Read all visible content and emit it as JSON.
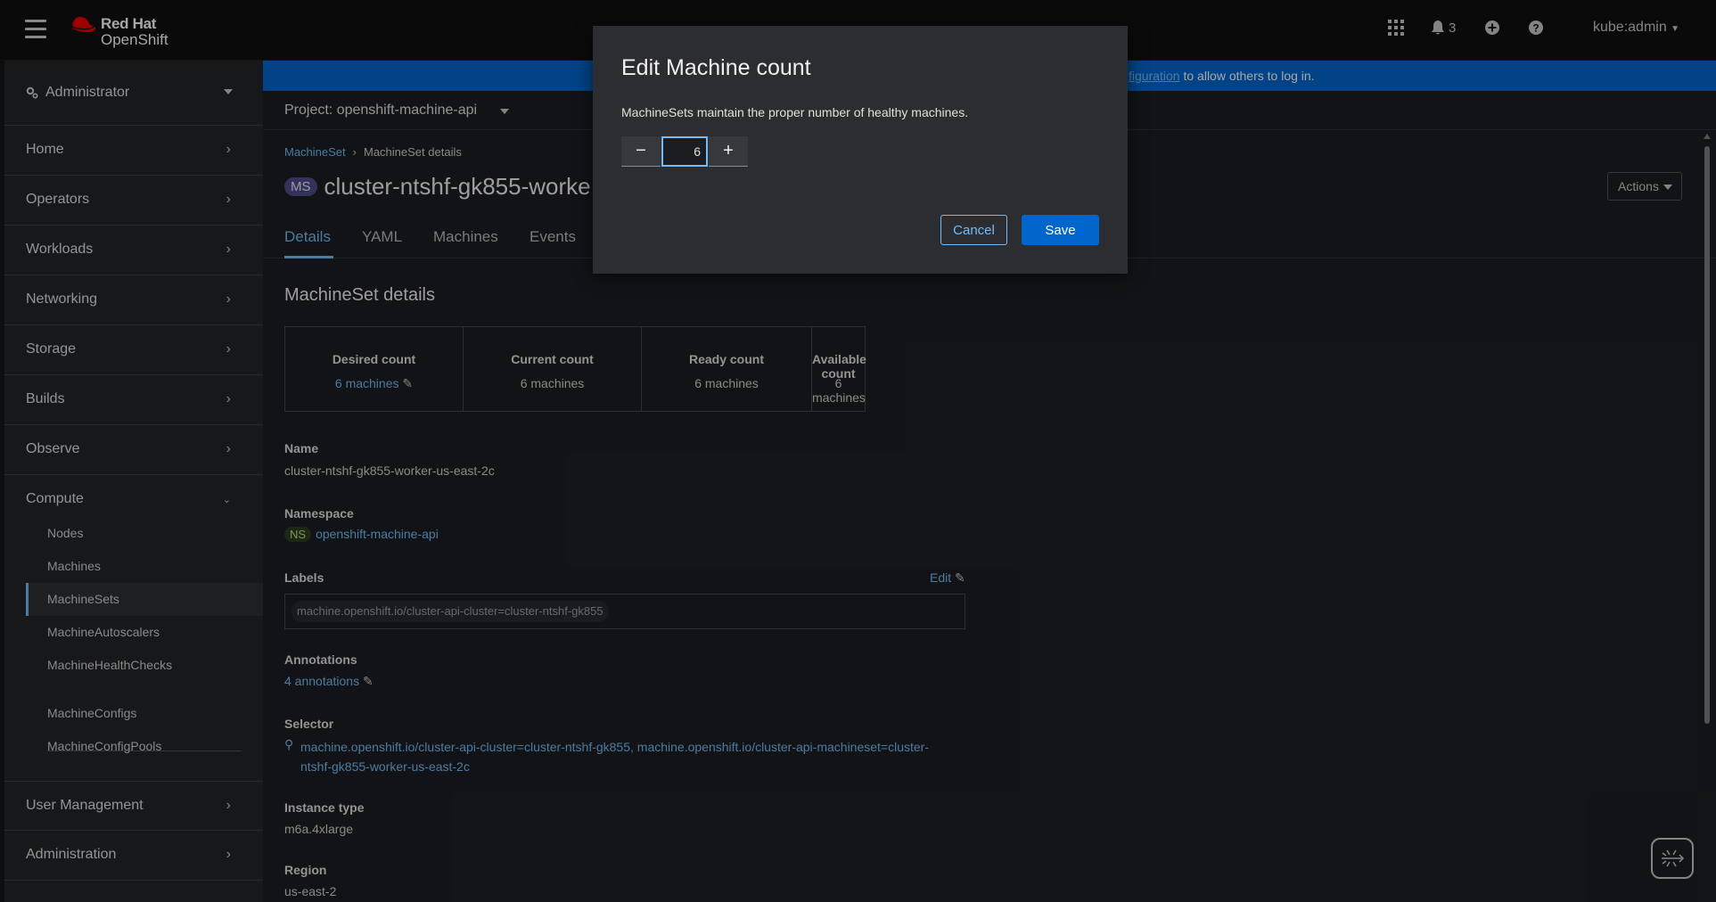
{
  "masthead": {
    "brand_line1": "Red Hat",
    "brand_line2": "OpenShift",
    "notifications_count": "3",
    "user": "kube:admin"
  },
  "sidebar": {
    "perspective": "Administrator",
    "groups": [
      {
        "label": "Home"
      },
      {
        "label": "Operators"
      },
      {
        "label": "Workloads"
      },
      {
        "label": "Networking"
      },
      {
        "label": "Storage"
      },
      {
        "label": "Builds"
      },
      {
        "label": "Observe"
      },
      {
        "label": "Compute"
      },
      {
        "label": "User Management"
      },
      {
        "label": "Administration"
      }
    ],
    "compute_items": [
      {
        "label": "Nodes"
      },
      {
        "label": "Machines"
      },
      {
        "label": "MachineSets"
      },
      {
        "label": "MachineAutoscalers"
      },
      {
        "label": "MachineHealthChecks"
      },
      {
        "label": "MachineConfigs"
      },
      {
        "label": "MachineConfigPools"
      }
    ],
    "active_item": "MachineSets"
  },
  "banner": {
    "link_fragment": "figuration",
    "text": " to allow others to log in."
  },
  "project": {
    "label": "Project: openshift-machine-api"
  },
  "breadcrumb": {
    "parent": "MachineSet",
    "current": "MachineSet details"
  },
  "page": {
    "badge": "MS",
    "title": "cluster-ntshf-gk855-worke",
    "actions_label": "Actions"
  },
  "tabs": [
    {
      "label": "Details"
    },
    {
      "label": "YAML"
    },
    {
      "label": "Machines"
    },
    {
      "label": "Events"
    }
  ],
  "details": {
    "heading": "MachineSet details",
    "counts": [
      {
        "title": "Desired count",
        "value": "6 machines"
      },
      {
        "title": "Current count",
        "value": "6 machines"
      },
      {
        "title": "Ready count",
        "value": "6 machines"
      },
      {
        "title": "Available count",
        "value": "6 machines"
      }
    ],
    "name_label": "Name",
    "name_value": "cluster-ntshf-gk855-worker-us-east-2c",
    "namespace_label": "Namespace",
    "namespace_badge": "NS",
    "namespace_value": "openshift-machine-api",
    "labels_label": "Labels",
    "labels_edit": "Edit",
    "label_chip": "machine.openshift.io/cluster-api-cluster=cluster-ntshf-gk855",
    "annotations_label": "Annotations",
    "annotations_value": "4 annotations",
    "selector_label": "Selector",
    "selector_line1": "machine.openshift.io/cluster-api-cluster=cluster-ntshf-gk855, machine.openshift.io/cluster-api-machineset=cluster-",
    "selector_line2": "ntshf-gk855-worker-us-east-2c",
    "instance_label": "Instance type",
    "instance_value": "m6a.4xlarge",
    "region_label": "Region",
    "region_value": "us-east-2"
  },
  "modal": {
    "title": "Edit Machine count",
    "description": "MachineSets maintain the proper number of healthy machines.",
    "minus": "−",
    "plus": "+",
    "count_value": "6",
    "cancel": "Cancel",
    "save": "Save"
  },
  "colors": {
    "accent": "#73bcf7",
    "primary": "#0066cc",
    "brand_red": "#ee0000"
  },
  "icons": [
    "hamburger-icon",
    "redhat-logo",
    "app-launcher-icon",
    "bell-icon",
    "plus-circle-icon",
    "help-icon",
    "gear-icon",
    "chevron-right-icon",
    "chevron-down-icon",
    "pencil-icon",
    "search-icon",
    "quick-start-icon"
  ]
}
